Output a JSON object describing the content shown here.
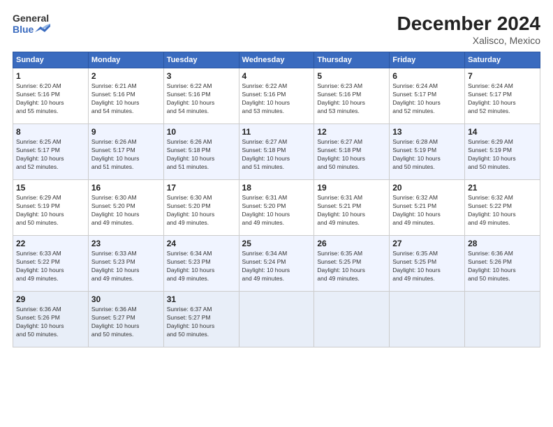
{
  "logo": {
    "line1": "General",
    "line2": "Blue"
  },
  "title": "December 2024",
  "location": "Xalisco, Mexico",
  "days_header": [
    "Sunday",
    "Monday",
    "Tuesday",
    "Wednesday",
    "Thursday",
    "Friday",
    "Saturday"
  ],
  "weeks": [
    [
      {
        "day": "1",
        "info": "Sunrise: 6:20 AM\nSunset: 5:16 PM\nDaylight: 10 hours\nand 55 minutes."
      },
      {
        "day": "2",
        "info": "Sunrise: 6:21 AM\nSunset: 5:16 PM\nDaylight: 10 hours\nand 54 minutes."
      },
      {
        "day": "3",
        "info": "Sunrise: 6:22 AM\nSunset: 5:16 PM\nDaylight: 10 hours\nand 54 minutes."
      },
      {
        "day": "4",
        "info": "Sunrise: 6:22 AM\nSunset: 5:16 PM\nDaylight: 10 hours\nand 53 minutes."
      },
      {
        "day": "5",
        "info": "Sunrise: 6:23 AM\nSunset: 5:16 PM\nDaylight: 10 hours\nand 53 minutes."
      },
      {
        "day": "6",
        "info": "Sunrise: 6:24 AM\nSunset: 5:17 PM\nDaylight: 10 hours\nand 52 minutes."
      },
      {
        "day": "7",
        "info": "Sunrise: 6:24 AM\nSunset: 5:17 PM\nDaylight: 10 hours\nand 52 minutes."
      }
    ],
    [
      {
        "day": "8",
        "info": "Sunrise: 6:25 AM\nSunset: 5:17 PM\nDaylight: 10 hours\nand 52 minutes."
      },
      {
        "day": "9",
        "info": "Sunrise: 6:26 AM\nSunset: 5:17 PM\nDaylight: 10 hours\nand 51 minutes."
      },
      {
        "day": "10",
        "info": "Sunrise: 6:26 AM\nSunset: 5:18 PM\nDaylight: 10 hours\nand 51 minutes."
      },
      {
        "day": "11",
        "info": "Sunrise: 6:27 AM\nSunset: 5:18 PM\nDaylight: 10 hours\nand 51 minutes."
      },
      {
        "day": "12",
        "info": "Sunrise: 6:27 AM\nSunset: 5:18 PM\nDaylight: 10 hours\nand 50 minutes."
      },
      {
        "day": "13",
        "info": "Sunrise: 6:28 AM\nSunset: 5:19 PM\nDaylight: 10 hours\nand 50 minutes."
      },
      {
        "day": "14",
        "info": "Sunrise: 6:29 AM\nSunset: 5:19 PM\nDaylight: 10 hours\nand 50 minutes."
      }
    ],
    [
      {
        "day": "15",
        "info": "Sunrise: 6:29 AM\nSunset: 5:19 PM\nDaylight: 10 hours\nand 50 minutes."
      },
      {
        "day": "16",
        "info": "Sunrise: 6:30 AM\nSunset: 5:20 PM\nDaylight: 10 hours\nand 49 minutes."
      },
      {
        "day": "17",
        "info": "Sunrise: 6:30 AM\nSunset: 5:20 PM\nDaylight: 10 hours\nand 49 minutes."
      },
      {
        "day": "18",
        "info": "Sunrise: 6:31 AM\nSunset: 5:20 PM\nDaylight: 10 hours\nand 49 minutes."
      },
      {
        "day": "19",
        "info": "Sunrise: 6:31 AM\nSunset: 5:21 PM\nDaylight: 10 hours\nand 49 minutes."
      },
      {
        "day": "20",
        "info": "Sunrise: 6:32 AM\nSunset: 5:21 PM\nDaylight: 10 hours\nand 49 minutes."
      },
      {
        "day": "21",
        "info": "Sunrise: 6:32 AM\nSunset: 5:22 PM\nDaylight: 10 hours\nand 49 minutes."
      }
    ],
    [
      {
        "day": "22",
        "info": "Sunrise: 6:33 AM\nSunset: 5:22 PM\nDaylight: 10 hours\nand 49 minutes."
      },
      {
        "day": "23",
        "info": "Sunrise: 6:33 AM\nSunset: 5:23 PM\nDaylight: 10 hours\nand 49 minutes."
      },
      {
        "day": "24",
        "info": "Sunrise: 6:34 AM\nSunset: 5:23 PM\nDaylight: 10 hours\nand 49 minutes."
      },
      {
        "day": "25",
        "info": "Sunrise: 6:34 AM\nSunset: 5:24 PM\nDaylight: 10 hours\nand 49 minutes."
      },
      {
        "day": "26",
        "info": "Sunrise: 6:35 AM\nSunset: 5:25 PM\nDaylight: 10 hours\nand 49 minutes."
      },
      {
        "day": "27",
        "info": "Sunrise: 6:35 AM\nSunset: 5:25 PM\nDaylight: 10 hours\nand 49 minutes."
      },
      {
        "day": "28",
        "info": "Sunrise: 6:36 AM\nSunset: 5:26 PM\nDaylight: 10 hours\nand 50 minutes."
      }
    ],
    [
      {
        "day": "29",
        "info": "Sunrise: 6:36 AM\nSunset: 5:26 PM\nDaylight: 10 hours\nand 50 minutes."
      },
      {
        "day": "30",
        "info": "Sunrise: 6:36 AM\nSunset: 5:27 PM\nDaylight: 10 hours\nand 50 minutes."
      },
      {
        "day": "31",
        "info": "Sunrise: 6:37 AM\nSunset: 5:27 PM\nDaylight: 10 hours\nand 50 minutes."
      },
      {
        "day": "",
        "info": ""
      },
      {
        "day": "",
        "info": ""
      },
      {
        "day": "",
        "info": ""
      },
      {
        "day": "",
        "info": ""
      }
    ]
  ]
}
